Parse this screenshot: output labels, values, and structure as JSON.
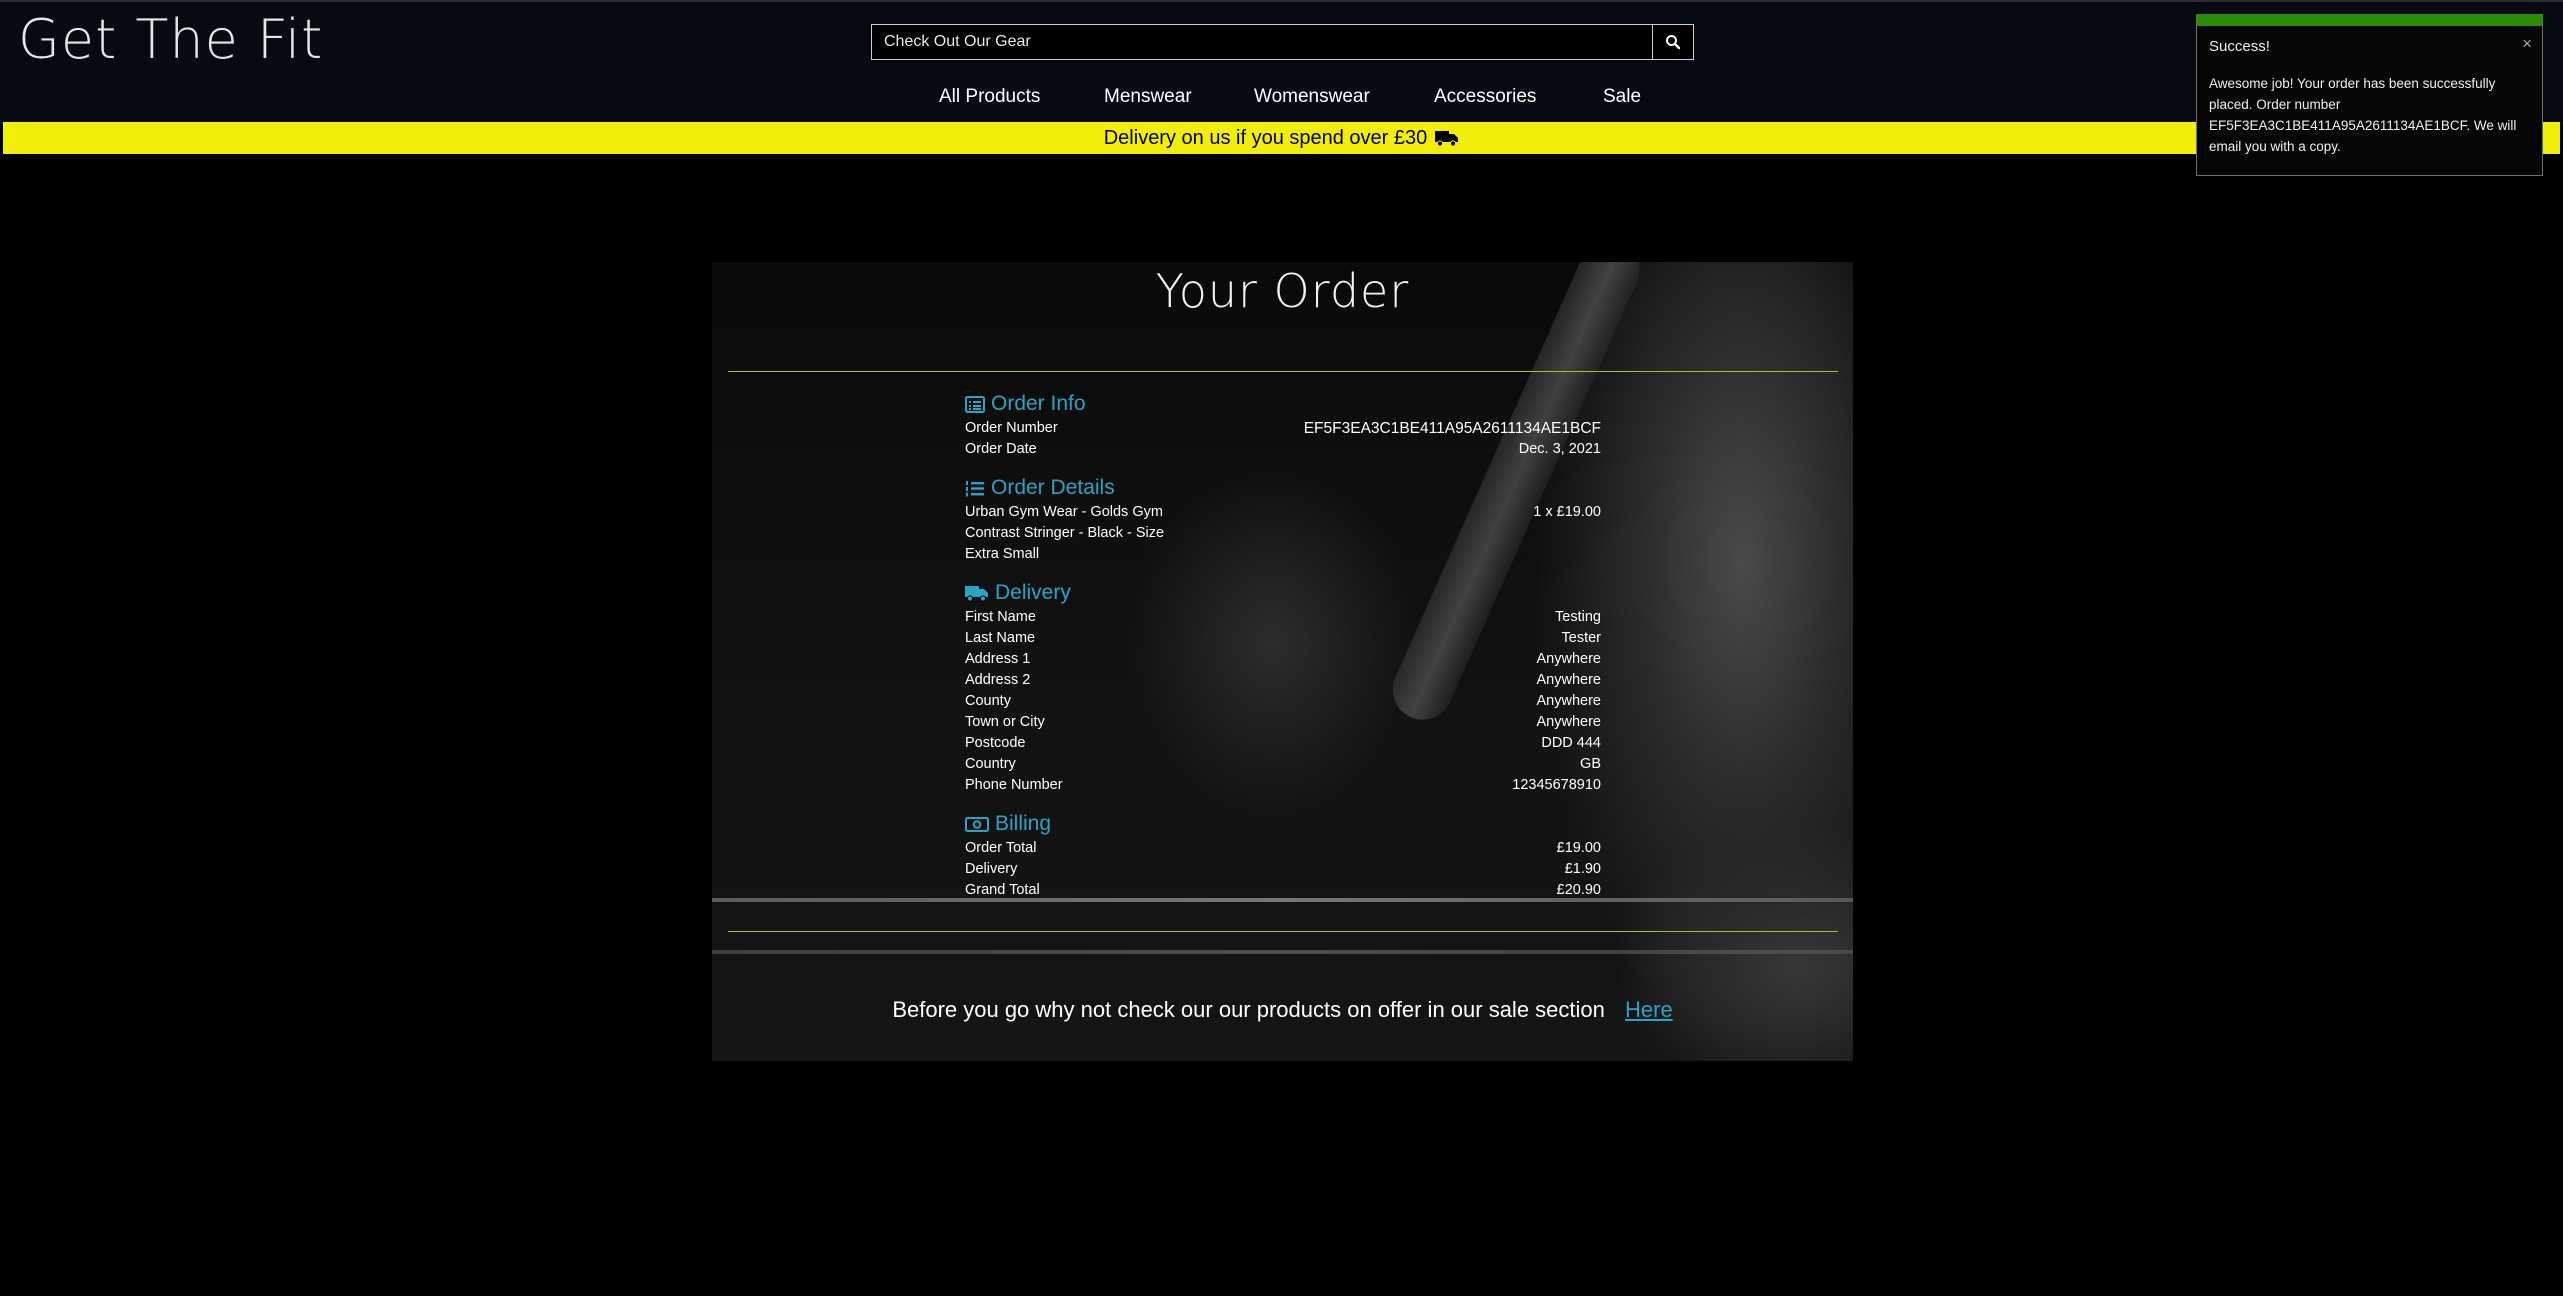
{
  "header": {
    "logo": "Get The Fit",
    "search": {
      "placeholder": "Check Out Our Gear"
    },
    "nav": [
      "All Products",
      "Menswear",
      "Womenswear",
      "Accessories",
      "Sale"
    ]
  },
  "banner": {
    "text": "Delivery on us if you spend over £30"
  },
  "toast": {
    "title": "Success!",
    "message": "Awesome job! Your order has been successfully placed. Order number EF5F3EA3C1BE411A95A2611134AE1BCF. We will email you with a copy.",
    "close": "×"
  },
  "order": {
    "title": "Your Order",
    "order_info": {
      "heading": "Order Info",
      "order_number_label": "Order Number",
      "order_number": "EF5F3EA3C1BE411A95A2611134AE1BCF",
      "order_date_label": "Order Date",
      "order_date": "Dec. 3, 2021"
    },
    "order_details": {
      "heading": "Order Details",
      "item": "Urban Gym Wear - Golds Gym Contrast Stringer - Black - Size Extra Small",
      "qty_price": "1 x £19.00"
    },
    "delivery": {
      "heading": "Delivery",
      "rows": [
        {
          "label": "First Name",
          "value": "Testing"
        },
        {
          "label": "Last Name",
          "value": "Tester"
        },
        {
          "label": "Address 1",
          "value": "Anywhere"
        },
        {
          "label": "Address 2",
          "value": "Anywhere"
        },
        {
          "label": "County",
          "value": "Anywhere"
        },
        {
          "label": "Town or City",
          "value": "Anywhere"
        },
        {
          "label": "Postcode",
          "value": "DDD 444"
        },
        {
          "label": "Country",
          "value": "GB"
        },
        {
          "label": "Phone Number",
          "value": "12345678910"
        }
      ]
    },
    "billing": {
      "heading": "Billing",
      "rows": [
        {
          "label": "Order Total",
          "value": "£19.00"
        },
        {
          "label": "Delivery",
          "value": "£1.90"
        },
        {
          "label": "Grand Total",
          "value": "£20.90"
        }
      ]
    },
    "footer": {
      "text": "Before you go why not check our our products on offer in our sale section",
      "link": "Here"
    }
  },
  "colors": {
    "accent": "#2aa3c9",
    "banner": "#f1ee0a",
    "success": "#2e8b08",
    "rule": "#b9b81a"
  }
}
